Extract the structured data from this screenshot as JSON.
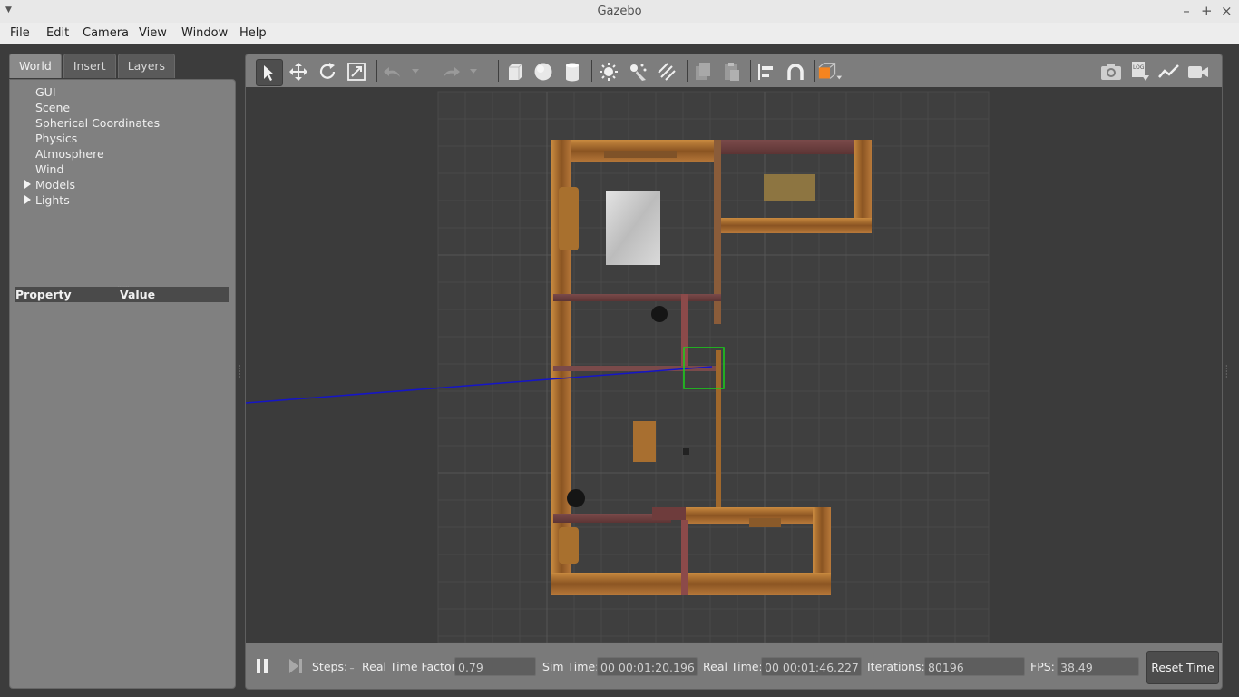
{
  "window": {
    "title": "Gazebo"
  },
  "menu": [
    "File",
    "Edit",
    "Camera",
    "View",
    "Window",
    "Help"
  ],
  "left_panel": {
    "tabs": [
      "World",
      "Insert",
      "Layers"
    ],
    "active_tab": "World",
    "tree": [
      {
        "label": "GUI",
        "expandable": false
      },
      {
        "label": "Scene",
        "expandable": false
      },
      {
        "label": "Spherical Coordinates",
        "expandable": false
      },
      {
        "label": "Physics",
        "expandable": false
      },
      {
        "label": "Atmosphere",
        "expandable": false
      },
      {
        "label": "Wind",
        "expandable": false
      },
      {
        "label": "Models",
        "expandable": true
      },
      {
        "label": "Lights",
        "expandable": true
      }
    ],
    "property_header": {
      "property": "Property",
      "value": "Value"
    }
  },
  "toolbar": {
    "tools": [
      "select-mode-icon",
      "translate-mode-icon",
      "rotate-mode-icon",
      "scale-mode-icon",
      "undo-icon",
      "undo-history-icon",
      "redo-icon",
      "redo-history-icon",
      "box-shape-icon",
      "sphere-shape-icon",
      "cylinder-shape-icon",
      "point-light-icon",
      "spot-light-icon",
      "directional-light-icon",
      "copy-icon",
      "paste-icon",
      "align-icon",
      "snap-icon",
      "view-angle-icon"
    ],
    "right_tools": [
      "screenshot-icon",
      "log-icon",
      "plot-icon",
      "video-record-icon"
    ],
    "log_label": "LOG",
    "accent_color": "#f5841f"
  },
  "bottom_bar": {
    "steps_label": "Steps:",
    "rtf_label": "Real Time Factor:",
    "rtf_value": "0.79",
    "sim_time_label": "Sim Time:",
    "sim_time_value": "00 00:01:20.196",
    "real_time_label": "Real Time:",
    "real_time_value": "00 00:01:46.227",
    "iterations_label": "Iterations:",
    "iterations_value": "80196",
    "fps_label": "FPS:",
    "fps_value": "38.49",
    "reset_label": "Reset Time"
  }
}
